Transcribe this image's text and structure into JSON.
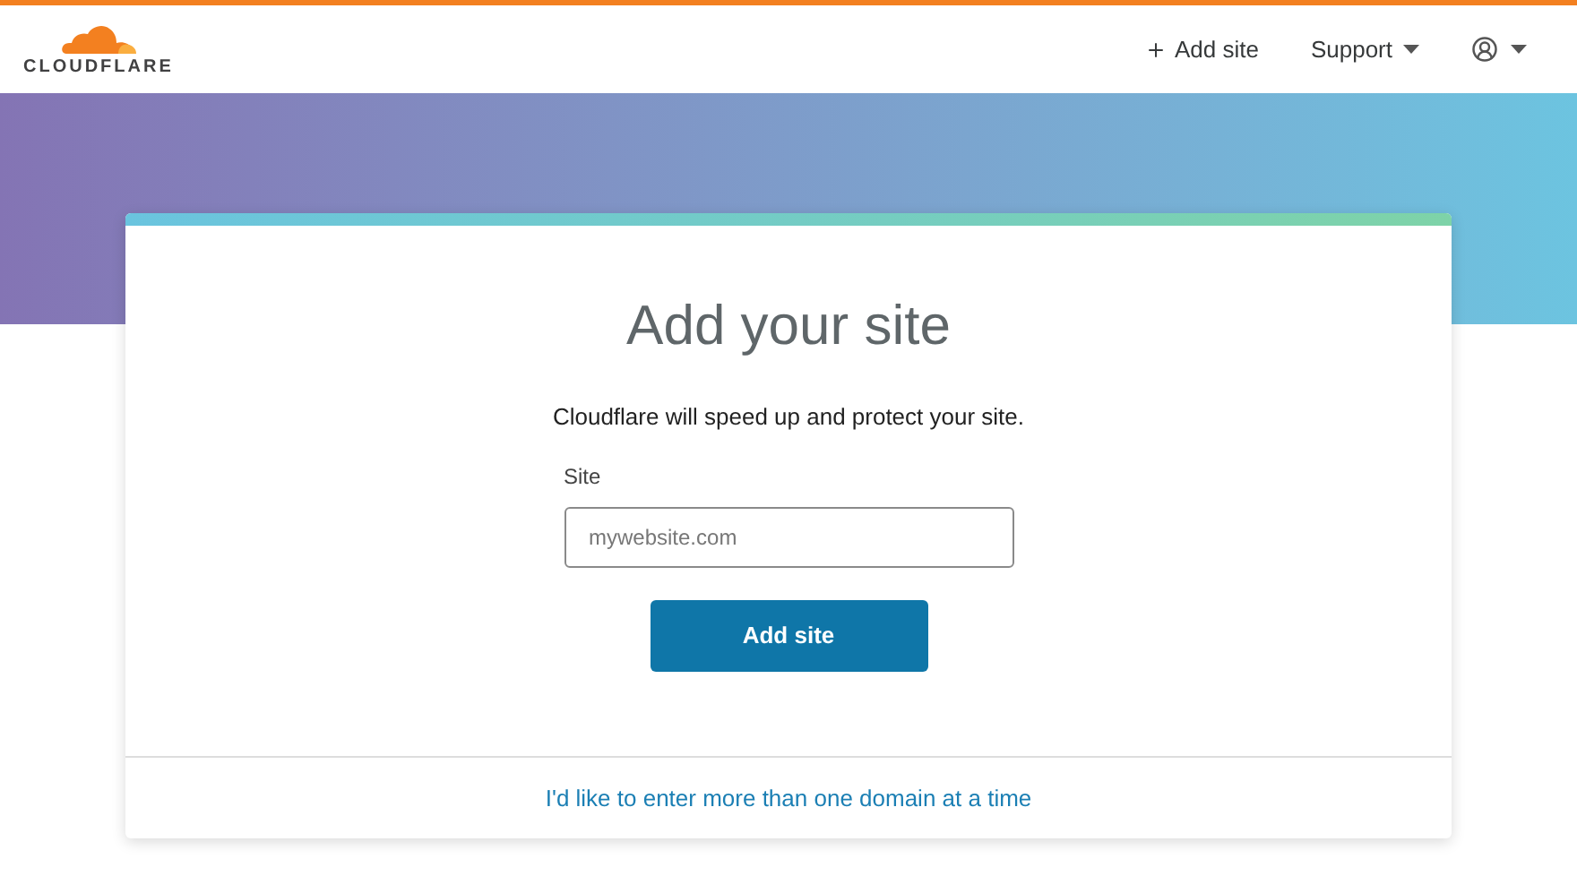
{
  "header": {
    "logo": "CLOUDFLARE",
    "nav": [
      {
        "kind": "add",
        "label": "Add site"
      },
      {
        "kind": "menu",
        "label": "Support"
      },
      {
        "kind": "account"
      }
    ]
  },
  "card": {
    "title": "Add your site",
    "subtitle": "Cloudflare will speed up and protect your site.",
    "field": {
      "label": "Site",
      "placeholder": "mywebsite.com"
    },
    "button": "Add site",
    "link": "I'd like to enter more than one domain at a time"
  }
}
